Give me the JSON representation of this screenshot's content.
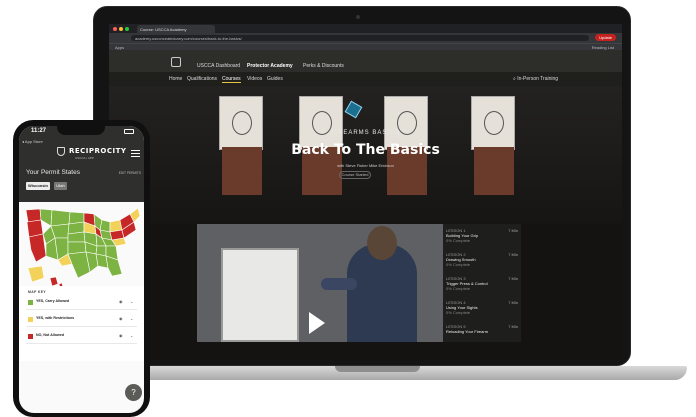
{
  "browser": {
    "tab_title": "Course: USCCA Academy",
    "url": "academy.usconcealedcarry.com/courses/back-to-the-basics/",
    "update_label": "Update",
    "apps_label": "Apps",
    "reading_list_label": "Reading List"
  },
  "site": {
    "top_nav": [
      "USCCA Dashboard",
      "Protector Academy",
      "Perks & Discounts"
    ],
    "top_nav_active": "Protector Academy",
    "sub_nav": [
      "Home",
      "Qualifications",
      "Courses",
      "Videos",
      "Guides"
    ],
    "sub_nav_active": "Courses",
    "in_person_training": "In-Person Training"
  },
  "hero": {
    "kicker": "FIREARMS BASICS",
    "title": "Back To The Basics",
    "with_line": "with   Steve Fisher   Mike Erickson",
    "status_pill": "Course Started"
  },
  "lessons": [
    {
      "number": "LESSON 1",
      "title": "Building Your Grip",
      "duration": "7 Min",
      "status": "0% Complete"
    },
    {
      "number": "LESSON 2",
      "title": "Drawing Smooth",
      "duration": "7 Min",
      "status": "0% Complete"
    },
    {
      "number": "LESSON 3",
      "title": "Trigger Press & Control",
      "duration": "7 Min",
      "status": "0% Complete"
    },
    {
      "number": "LESSON 4",
      "title": "Using Your Sights",
      "duration": "7 Min",
      "status": "0% Complete"
    },
    {
      "number": "LESSON 5",
      "title": "Reloading Your Firearm",
      "duration": "7 Min",
      "status": ""
    }
  ],
  "phone": {
    "time": "11:27",
    "back_label": "◂ App Store",
    "brand": "RECIPROCITY",
    "brand_sub": "USCCA • APP",
    "section_title": "Your Permit States",
    "edit_label": "EDIT PERMITS",
    "states": [
      "Wisconsin",
      "Utah"
    ],
    "map_key_title": "MAP KEY",
    "legend": [
      {
        "label": "YES, Carry Allowed",
        "color": "#7cb342"
      },
      {
        "label": "YES, with Restrictions",
        "color": "#f2d25a"
      },
      {
        "label": "NO, Not Allowed",
        "color": "#c62828"
      }
    ],
    "help_label": "?"
  },
  "colors": {
    "allowed": "#7cb342",
    "restricted": "#f2d25a",
    "not_allowed": "#c62828",
    "accent_gold": "#e8c349"
  }
}
